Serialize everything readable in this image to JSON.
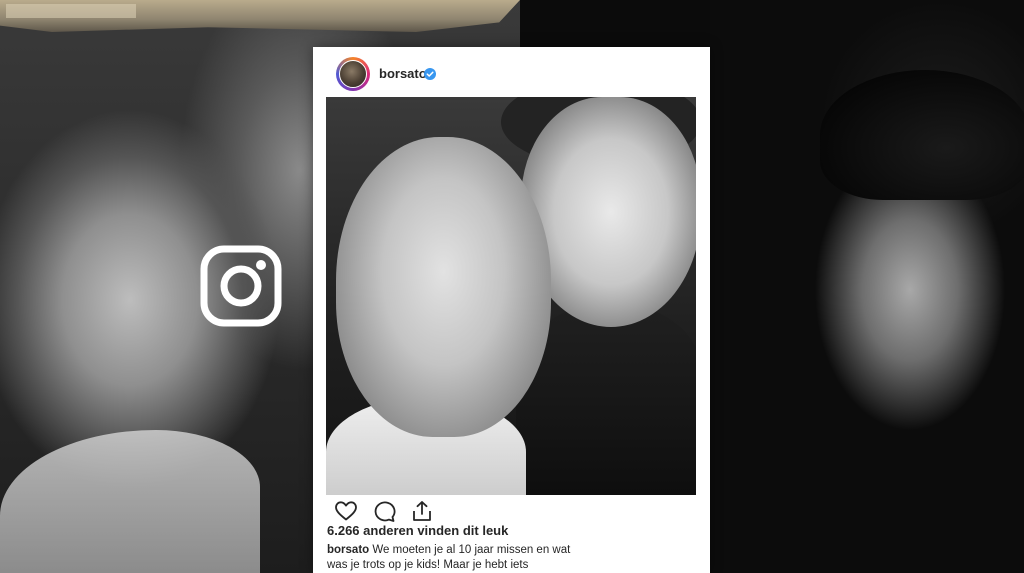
{
  "post": {
    "username": "borsato",
    "likes_text": "6.266 anderen vinden dit leuk",
    "caption_user": "borsato",
    "caption_text": "We moeten je al 10 jaar missen en wat was je trots op je kids! Maar je hebt iets"
  },
  "icons": {
    "overlay": "instagram-logo-icon",
    "verified": "verified-badge-icon",
    "like": "heart-icon",
    "comment": "comment-icon",
    "share": "share-icon"
  },
  "colors": {
    "card_background": "#ffffff",
    "verified_blue": "#3897f0",
    "text": "#262626"
  }
}
